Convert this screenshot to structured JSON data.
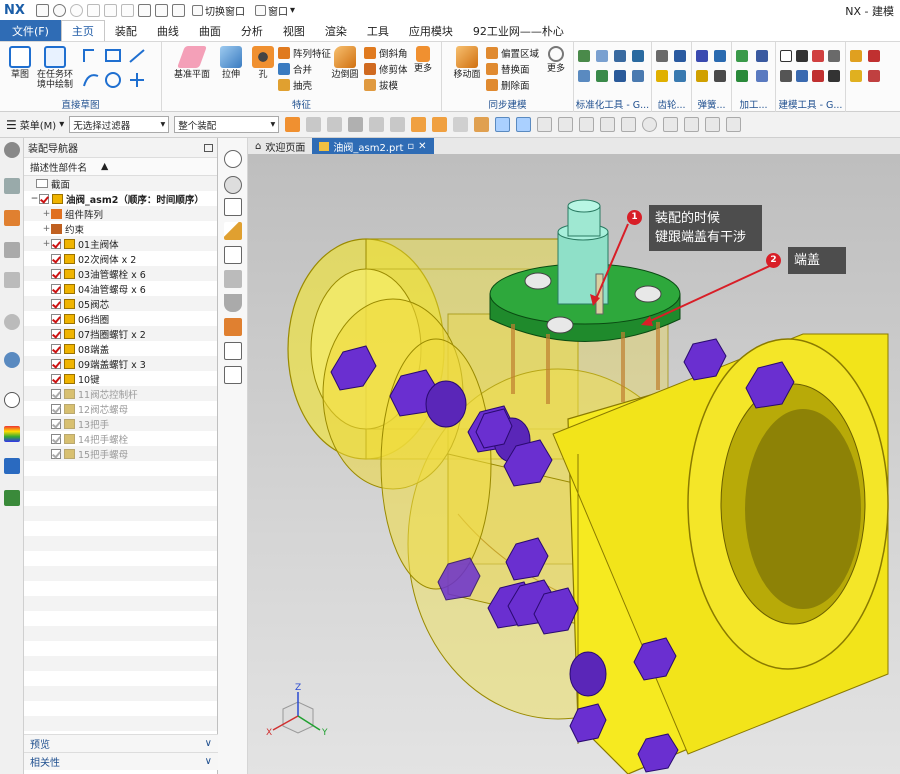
{
  "app": {
    "logo": "NX",
    "title": "NX - 建模"
  },
  "quick_access": {
    "switch_window": "切换窗口",
    "window": "窗口"
  },
  "tabs": [
    {
      "label": "文件(F)"
    },
    {
      "label": "主页"
    },
    {
      "label": "装配"
    },
    {
      "label": "曲线"
    },
    {
      "label": "曲面"
    },
    {
      "label": "分析"
    },
    {
      "label": "视图"
    },
    {
      "label": "渲染"
    },
    {
      "label": "工具"
    },
    {
      "label": "应用模块"
    },
    {
      "label": "92工业网——朴心"
    }
  ],
  "ribbon": {
    "sketch": {
      "btn_sketch": "草图",
      "btn_sketch_task": "在任务环境中绘制",
      "label": "直接草图"
    },
    "feature": {
      "btn_datum": "基准平面",
      "btn_extrude": "拉伸",
      "btn_hole": "孔",
      "pattern": "阵列特征",
      "unite": "合并",
      "shell": "抽壳",
      "edge_blend": "边倒圆",
      "chamfer": "倒斜角",
      "trim": "修剪体",
      "draft": "拔模",
      "more": "更多",
      "label": "特征"
    },
    "sync": {
      "move_face": "移动面",
      "offset_region": "偏置区域",
      "replace_face": "替换面",
      "delete_face": "删除面",
      "more": "更多",
      "label": "同步建模"
    },
    "groups_small": [
      "标准化工具 - G...",
      "齿轮...",
      "弹簧...",
      "加工...",
      "建模工具 - G..."
    ]
  },
  "toolbar": {
    "menu": "菜单(M)",
    "filter": "无选择过滤器",
    "scope": "整个装配"
  },
  "navigator": {
    "title": "装配导航器",
    "column": "描述性部件名",
    "items": [
      {
        "label": "截面"
      },
      {
        "label": "油阀_asm2（顺序：时间顺序）"
      },
      {
        "label": "组件阵列"
      },
      {
        "label": "约束"
      },
      {
        "label": "01主阀体"
      },
      {
        "label": "02次阀体 x 2"
      },
      {
        "label": "03油管螺栓 x 6"
      },
      {
        "label": "04油管螺母 x 6"
      },
      {
        "label": "05阀芯"
      },
      {
        "label": "06挡圈"
      },
      {
        "label": "07挡圈螺钉 x 2"
      },
      {
        "label": "08端盖"
      },
      {
        "label": "09端盖螺钉 x 3"
      },
      {
        "label": "10键"
      },
      {
        "label": "11阀芯控制杆"
      },
      {
        "label": "12阀芯螺母"
      },
      {
        "label": "13把手"
      },
      {
        "label": "14把手螺栓"
      },
      {
        "label": "15把手螺母"
      }
    ],
    "preview": "预览",
    "dependencies": "相关性"
  },
  "doc_tabs": {
    "welcome": "欢迎页面",
    "part": "油阀_asm2.prt"
  },
  "callouts": [
    {
      "number": "1",
      "line1": "装配的时候",
      "line2": "键跟端盖有干涉"
    },
    {
      "number": "2",
      "line1": "端盖",
      "line2": ""
    }
  ],
  "triad": {
    "x": "X",
    "y": "Y",
    "z": "Z"
  },
  "colors": {
    "ribbon_blue": "#2f6cb5",
    "body_yellow": "#f2e51a",
    "bolt_purple": "#6a2fd0",
    "cap_green": "#2e9e3a",
    "callout_red": "#d81e27"
  }
}
